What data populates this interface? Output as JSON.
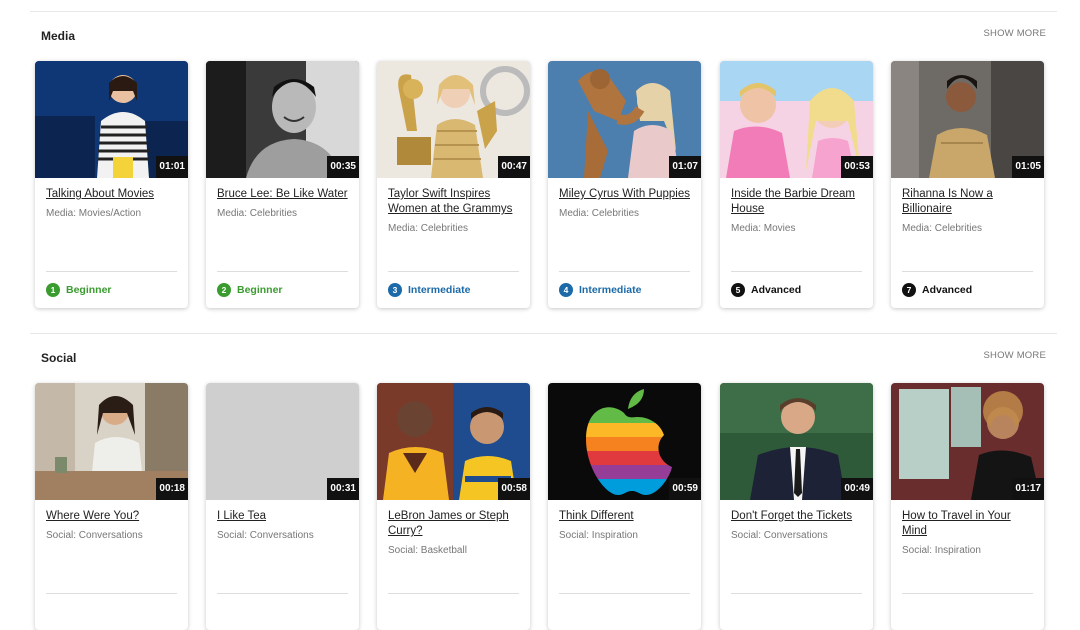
{
  "sections": [
    {
      "title": "Media",
      "show_more": "SHOW MORE",
      "cards": [
        {
          "title": "Talking About Movies",
          "category": "Media: Movies/Action",
          "duration": "01:01",
          "level_num": "1",
          "level": "Beginner",
          "level_color": "#3a9b2f"
        },
        {
          "title": "Bruce Lee: Be Like Water",
          "category": "Media: Celebrities",
          "duration": "00:35",
          "level_num": "2",
          "level": "Beginner",
          "level_color": "#3a9b2f"
        },
        {
          "title": "Taylor Swift Inspires Women at the Grammys",
          "category": "Media: Celebrities",
          "duration": "00:47",
          "level_num": "3",
          "level": "Intermediate",
          "level_color": "#1c6aa8"
        },
        {
          "title": "Miley Cyrus With Puppies",
          "category": "Media: Celebrities",
          "duration": "01:07",
          "level_num": "4",
          "level": "Intermediate",
          "level_color": "#1c6aa8"
        },
        {
          "title": "Inside the Barbie Dream House",
          "category": "Media: Movies",
          "duration": "00:53",
          "level_num": "5",
          "level": "Advanced",
          "level_color": "#111111"
        },
        {
          "title": "Rihanna Is Now a Billionaire",
          "category": "Media: Celebrities",
          "duration": "01:05",
          "level_num": "7",
          "level": "Advanced",
          "level_color": "#111111"
        }
      ]
    },
    {
      "title": "Social",
      "show_more": "SHOW MORE",
      "cards": [
        {
          "title": "Where Were You?",
          "category": "Social: Conversations",
          "duration": "00:18"
        },
        {
          "title": "I Like Tea",
          "category": "Social: Conversations",
          "duration": "00:31"
        },
        {
          "title": "LeBron James or Steph Curry?",
          "category": "Social: Basketball",
          "duration": "00:58"
        },
        {
          "title": "Think Different",
          "category": "Social: Inspiration",
          "duration": "00:59"
        },
        {
          "title": "Don't Forget the Tickets",
          "category": "Social: Conversations",
          "duration": "00:49"
        },
        {
          "title": "How to Travel in Your Mind",
          "category": "Social: Inspiration",
          "duration": "01:17"
        }
      ]
    }
  ]
}
